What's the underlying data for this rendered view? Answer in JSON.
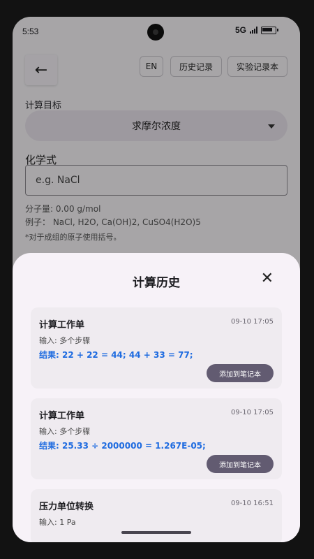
{
  "status_bar": {
    "time": "5:53",
    "network": "5G"
  },
  "app_bar": {
    "back_icon": "arrow-left-icon",
    "back_glyph": "←",
    "lang_button": "EN",
    "history_button": "历史记录",
    "lab_notebook_button": "实验记录本"
  },
  "form": {
    "target_label": "计算目标",
    "target_value": "求摩尔浓度",
    "formula_label": "化学式",
    "formula_placeholder": "e.g. NaCl",
    "molecular_weight": "分子量: 0.00 g/mol",
    "examples": "例子： NaCl, H2O, Ca(OH)2, CuSO4(H2O)5",
    "hint": "*对于成组的原子使用括号。"
  },
  "history_sheet": {
    "title": "计算历史",
    "close_glyph": "✕",
    "items": [
      {
        "title": "计算工作单",
        "time": "09-10 17:05",
        "input": "输入: 多个步骤",
        "result": "结果: 22 + 22 = 44; 44 + 33 = 77;",
        "add_button": "添加到笔记本"
      },
      {
        "title": "计算工作单",
        "time": "09-10 17:05",
        "input": "输入: 多个步骤",
        "result": "结果: 25.33 ÷ 2000000 = 1.267E-05;",
        "add_button": "添加到笔记本"
      },
      {
        "title": "压力单位转换",
        "time": "09-10 16:51",
        "input": "输入: 1 Pa"
      }
    ]
  },
  "colors": {
    "accent": "#625b71",
    "result_text": "#1e6be0",
    "sheet_bg": "#f7f2f8"
  }
}
